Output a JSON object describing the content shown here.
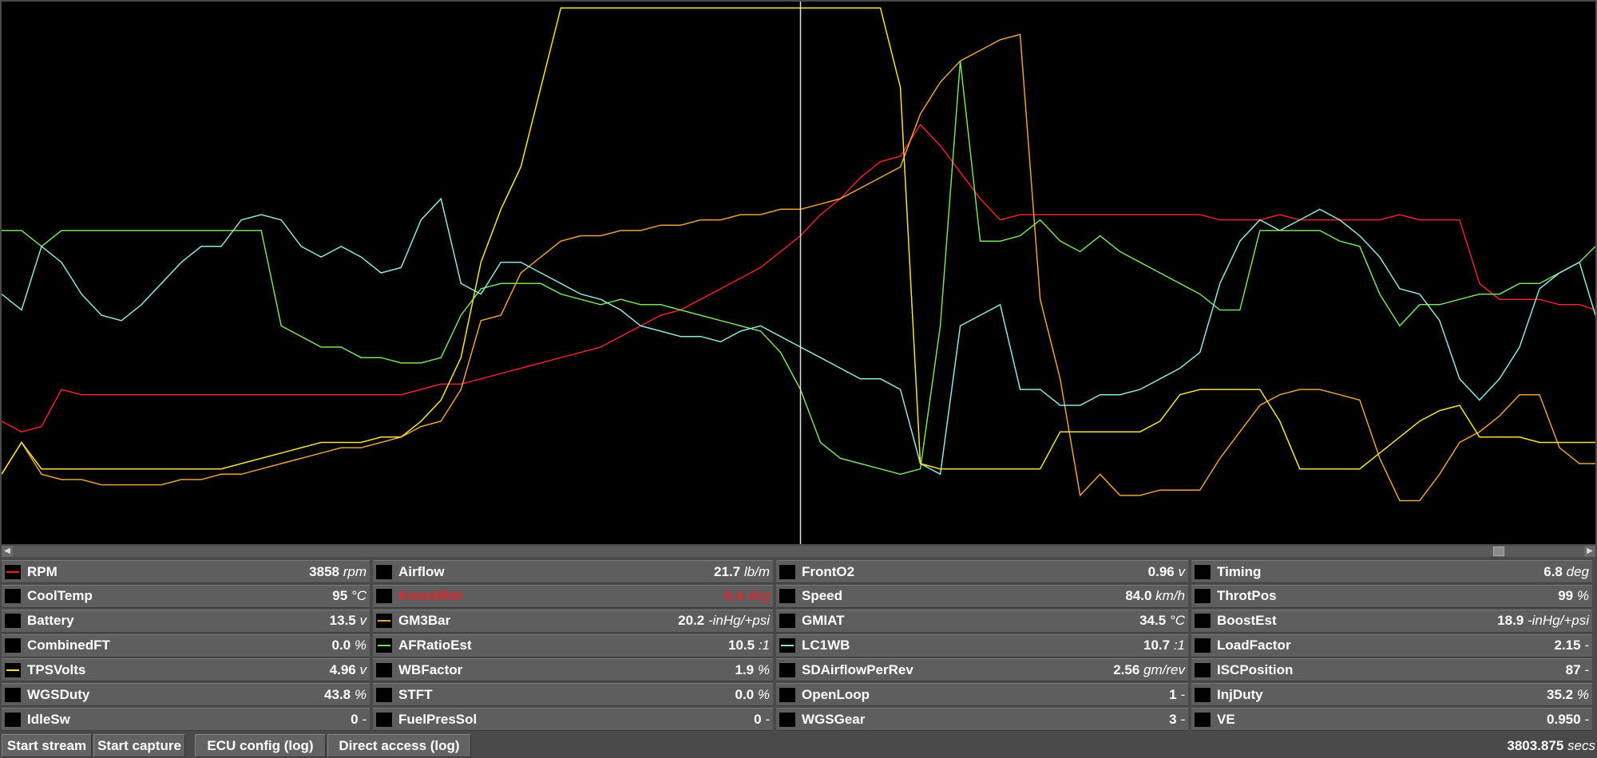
{
  "colors": {
    "rpm": "#e8252c",
    "gm3bar": "#e6a43b",
    "afratio": "#7be05a",
    "lc1wb": "#8fe6df",
    "tpsvolts": "#f4e43a",
    "cursor": "#dddddd"
  },
  "chart_data": {
    "type": "line",
    "title": "",
    "xlabel": "",
    "ylabel": "",
    "ylim": [
      0,
      100
    ],
    "x": [
      0,
      25,
      50,
      75,
      100,
      125,
      150,
      175,
      200,
      225,
      250,
      275,
      300,
      325,
      350,
      375,
      400,
      425,
      450,
      475,
      500,
      525,
      550,
      575,
      600,
      625,
      650,
      675,
      700,
      725,
      750,
      775,
      800,
      825,
      850,
      875,
      900,
      925,
      950,
      975,
      1000,
      1025,
      1050,
      1075,
      1100,
      1125,
      1150,
      1175,
      1200,
      1225,
      1250,
      1275,
      1300,
      1325,
      1350,
      1375,
      1400,
      1425,
      1450,
      1475,
      1500,
      1525,
      1550,
      1575,
      1600,
      1625,
      1650,
      1675,
      1700,
      1725,
      1750,
      1775,
      1800,
      1825,
      1850,
      1875,
      1900,
      1925,
      1950,
      1975,
      1995
    ],
    "series": [
      {
        "key": "rpm",
        "values": [
          22,
          20,
          21,
          28,
          27,
          27,
          27,
          27,
          27,
          27,
          27,
          27,
          27,
          27,
          27,
          27,
          27,
          27,
          27,
          27,
          27,
          28,
          29,
          29,
          30,
          31,
          32,
          33,
          34,
          35,
          36,
          38,
          40,
          42,
          43,
          45,
          47,
          49,
          51,
          54,
          57,
          61,
          64,
          68,
          71,
          72,
          78,
          74,
          69,
          64,
          60,
          61,
          61,
          61,
          61,
          61,
          61,
          61,
          61,
          61,
          61,
          60,
          60,
          60,
          61,
          60,
          60,
          60,
          60,
          60,
          61,
          60,
          60,
          60,
          48,
          45,
          45,
          45,
          44,
          44,
          43
        ]
      },
      {
        "key": "gm3bar",
        "values": [
          12,
          18,
          12,
          11,
          11,
          10,
          10,
          10,
          10,
          11,
          11,
          12,
          12,
          13,
          14,
          15,
          16,
          17,
          17,
          18,
          19,
          21,
          22,
          28,
          41,
          42,
          50,
          53,
          56,
          57,
          57,
          58,
          58,
          59,
          59,
          60,
          60,
          61,
          61,
          62,
          62,
          63,
          64,
          66,
          68,
          70,
          80,
          86,
          90,
          92,
          94,
          95,
          45,
          30,
          8,
          12,
          8,
          8,
          9,
          9,
          9,
          15,
          20,
          25,
          27,
          28,
          28,
          27,
          26,
          15,
          7,
          7,
          12,
          18,
          20,
          23,
          27,
          27,
          17,
          14,
          14
        ]
      },
      {
        "key": "afratio",
        "values": [
          58,
          58,
          55,
          58,
          58,
          58,
          58,
          58,
          58,
          58,
          58,
          58,
          58,
          58,
          40,
          38,
          36,
          36,
          34,
          34,
          33,
          33,
          34,
          42,
          47,
          48,
          48,
          48,
          46,
          45,
          44,
          45,
          44,
          44,
          43,
          42,
          41,
          40,
          39,
          35,
          28,
          18,
          15,
          14,
          13,
          12,
          13,
          40,
          90,
          56,
          56,
          57,
          60,
          56,
          54,
          57,
          54,
          52,
          50,
          48,
          46,
          43,
          43,
          58,
          58,
          58,
          58,
          56,
          55,
          46,
          40,
          44,
          44,
          45,
          46,
          46,
          48,
          48,
          50,
          52,
          55
        ]
      },
      {
        "key": "lc1wb",
        "values": [
          46,
          43,
          55,
          52,
          46,
          42,
          41,
          44,
          48,
          52,
          55,
          55,
          60,
          61,
          60,
          55,
          53,
          55,
          53,
          50,
          51,
          60,
          64,
          48,
          46,
          52,
          52,
          50,
          48,
          46,
          45,
          43,
          40,
          39,
          38,
          38,
          37,
          39,
          40,
          38,
          36,
          34,
          32,
          30,
          30,
          28,
          14,
          12,
          40,
          42,
          44,
          28,
          28,
          25,
          25,
          27,
          27,
          28,
          30,
          32,
          35,
          48,
          56,
          60,
          58,
          60,
          62,
          60,
          57,
          53,
          47,
          46,
          41,
          30,
          26,
          30,
          36,
          47,
          50,
          52,
          42
        ]
      },
      {
        "key": "tpsvolts",
        "values": [
          12,
          18,
          13,
          13,
          13,
          13,
          13,
          13,
          13,
          13,
          13,
          13,
          14,
          15,
          16,
          17,
          18,
          18,
          18,
          19,
          19,
          22,
          26,
          34,
          52,
          62,
          70,
          85,
          100,
          100,
          100,
          100,
          100,
          100,
          100,
          100,
          100,
          100,
          100,
          100,
          100,
          100,
          100,
          100,
          100,
          85,
          14,
          13,
          13,
          13,
          13,
          13,
          13,
          20,
          20,
          20,
          20,
          20,
          22,
          27,
          28,
          28,
          28,
          28,
          22,
          13,
          13,
          13,
          13,
          16,
          19,
          22,
          24,
          25,
          19,
          19,
          19,
          18,
          18,
          18,
          18
        ]
      }
    ],
    "cursor_x": 1000
  },
  "params": {
    "col1": [
      {
        "name": "RPM",
        "value": "3858",
        "unit": "rpm",
        "color_key": "rpm"
      },
      {
        "name": "CoolTemp",
        "value": "95",
        "unit": "°C"
      },
      {
        "name": "Battery",
        "value": "13.5",
        "unit": "v"
      },
      {
        "name": "CombinedFT",
        "value": "0.0",
        "unit": "%"
      },
      {
        "name": "TPSVolts",
        "value": "4.96",
        "unit": "v",
        "color_key": "tpsvolts"
      },
      {
        "name": "WGSDuty",
        "value": "43.8",
        "unit": "%"
      },
      {
        "name": "IdleSw",
        "value": "0",
        "unit": "-"
      }
    ],
    "col2": [
      {
        "name": "Airflow",
        "value": "21.7",
        "unit": "lb/m"
      },
      {
        "name": "KnockRet",
        "value": "0.4",
        "unit": "deg",
        "warn": true
      },
      {
        "name": "GM3Bar",
        "value": "20.2",
        "unit": "-inHg/+psi",
        "color_key": "gm3bar"
      },
      {
        "name": "AFRatioEst",
        "value": "10.5",
        "unit": ":1",
        "color_key": "afratio"
      },
      {
        "name": "WBFactor",
        "value": "1.9",
        "unit": "%"
      },
      {
        "name": "STFT",
        "value": "0.0",
        "unit": "%"
      },
      {
        "name": "FuelPresSol",
        "value": "0",
        "unit": "-"
      }
    ],
    "col3": [
      {
        "name": "FrontO2",
        "value": "0.96",
        "unit": "v"
      },
      {
        "name": "Speed",
        "value": "84.0",
        "unit": "km/h"
      },
      {
        "name": "GMIAT",
        "value": "34.5",
        "unit": "°C"
      },
      {
        "name": "LC1WB",
        "value": "10.7",
        "unit": ":1",
        "color_key": "lc1wb"
      },
      {
        "name": "SDAirflowPerRev",
        "value": "2.56",
        "unit": "gm/rev"
      },
      {
        "name": "OpenLoop",
        "value": "1",
        "unit": "-"
      },
      {
        "name": "WGSGear",
        "value": "3",
        "unit": "-"
      }
    ],
    "col4": [
      {
        "name": "Timing",
        "value": "6.8",
        "unit": "deg"
      },
      {
        "name": "ThrotPos",
        "value": "99",
        "unit": "%"
      },
      {
        "name": "BoostEst",
        "value": "18.9",
        "unit": "-inHg/+psi"
      },
      {
        "name": "LoadFactor",
        "value": "2.15",
        "unit": "-"
      },
      {
        "name": "ISCPosition",
        "value": "87",
        "unit": "-"
      },
      {
        "name": "InjDuty",
        "value": "35.2",
        "unit": "%"
      },
      {
        "name": "VE",
        "value": "0.950",
        "unit": "-"
      }
    ]
  },
  "toolbar": {
    "start_stream": "Start stream",
    "start_capture": "Start capture",
    "ecu_config": "ECU config (log)",
    "direct_access": "Direct access (log)"
  },
  "status": {
    "time_value": "3803.875",
    "time_unit": "secs"
  }
}
